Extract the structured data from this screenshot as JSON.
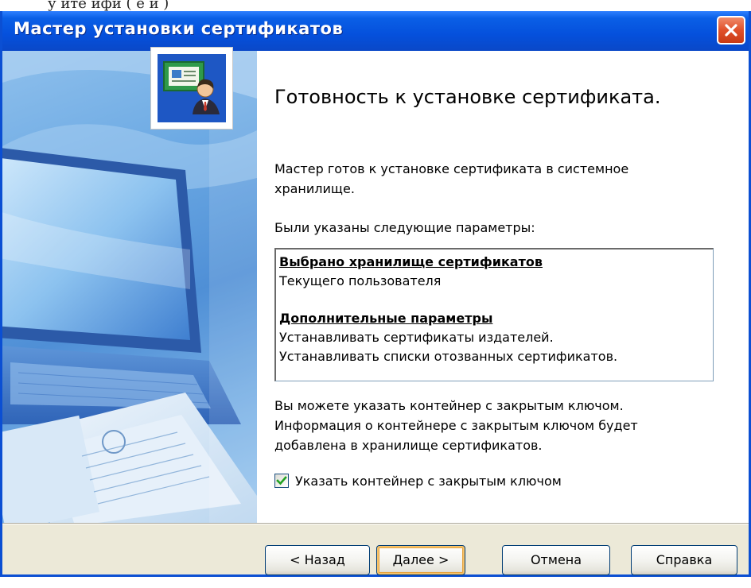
{
  "page_strip_text": "у      ите   ифи     ( е     и  )",
  "window": {
    "title": "Мастер установки сертификатов"
  },
  "content": {
    "heading": "Готовность к установке сертификата.",
    "intro": "Мастер готов к установке сертификата в системное хранилище.",
    "params_label": "Были указаны следующие параметры:",
    "params": {
      "section1_title": "Выбрано хранилище сертификатов",
      "section1_value": "Текущего пользователя",
      "section2_title": "Дополнительные параметры",
      "section2_line1": "Устанавливать сертификаты издателей.",
      "section2_line2": "Устанавливать списки отозванных сертификатов."
    },
    "container_info": "Вы можете указать контейнер с закрытым ключом. Информация о контейнере с закрытым ключом будет добавлена в хранилище сертификатов.",
    "checkbox_label": "Указать контейнер с закрытым ключом",
    "checkbox_checked": true
  },
  "buttons": {
    "back": "< Назад",
    "next": "Далее >",
    "cancel": "Отмена",
    "help": "Справка"
  },
  "icons": {
    "close": "close-icon",
    "certificate": "certificate-user-icon",
    "check": "check-icon"
  },
  "colors": {
    "titlebar": "#0550dc",
    "close_button": "#e0502a",
    "dialog_face": "#ece9d8",
    "default_button_highlight": "#f5c26b"
  }
}
